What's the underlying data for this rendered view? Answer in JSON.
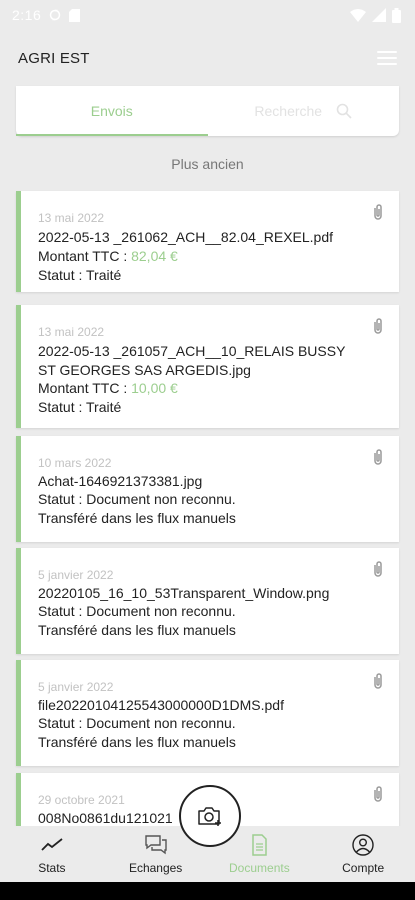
{
  "status_bar": {
    "time": "2:16"
  },
  "app_bar": {
    "title": "AGRI EST"
  },
  "tabs": {
    "envois": "Envois",
    "recherche": "Recherche"
  },
  "older_label": "Plus ancien",
  "colors": {
    "accent": "#9cce8f",
    "background": "#ebebeb"
  },
  "documents": [
    {
      "date": "13 mai 2022",
      "file": "2022-05-13 _261062_ACH__82.04_REXEL.pdf",
      "amount_label": "Montant TTC : ",
      "amount": "82,04 €",
      "status": "Statut : Traité"
    },
    {
      "date": "13 mai 2022",
      "file_line1": "2022-05-13 _261057_ACH__10_RELAIS BUSSY",
      "file_line2": "ST GEORGES SAS ARGEDIS.jpg",
      "amount_label": "Montant TTC : ",
      "amount": "10,00 €",
      "status": "Statut : Traité"
    },
    {
      "date": "10 mars 2022",
      "file": "Achat-1646921373381.jpg",
      "status": "Statut : Document non reconnu.",
      "note": "Transféré dans les flux manuels"
    },
    {
      "date": "5 janvier 2022",
      "file": "20220105_16_10_53Transparent_Window.png",
      "status": "Statut : Document non reconnu.",
      "note": "Transféré dans les flux manuels"
    },
    {
      "date": "5 janvier 2022",
      "file": "file20220104125543000000D1DMS.pdf",
      "status": "Statut : Document non reconnu.",
      "note": "Transféré dans les flux manuels"
    },
    {
      "date": "29 octobre 2021",
      "file": "008No0861du121021"
    }
  ],
  "bottom_nav": {
    "stats": "Stats",
    "echanges": "Echanges",
    "documents": "Documents",
    "compte": "Compte"
  }
}
